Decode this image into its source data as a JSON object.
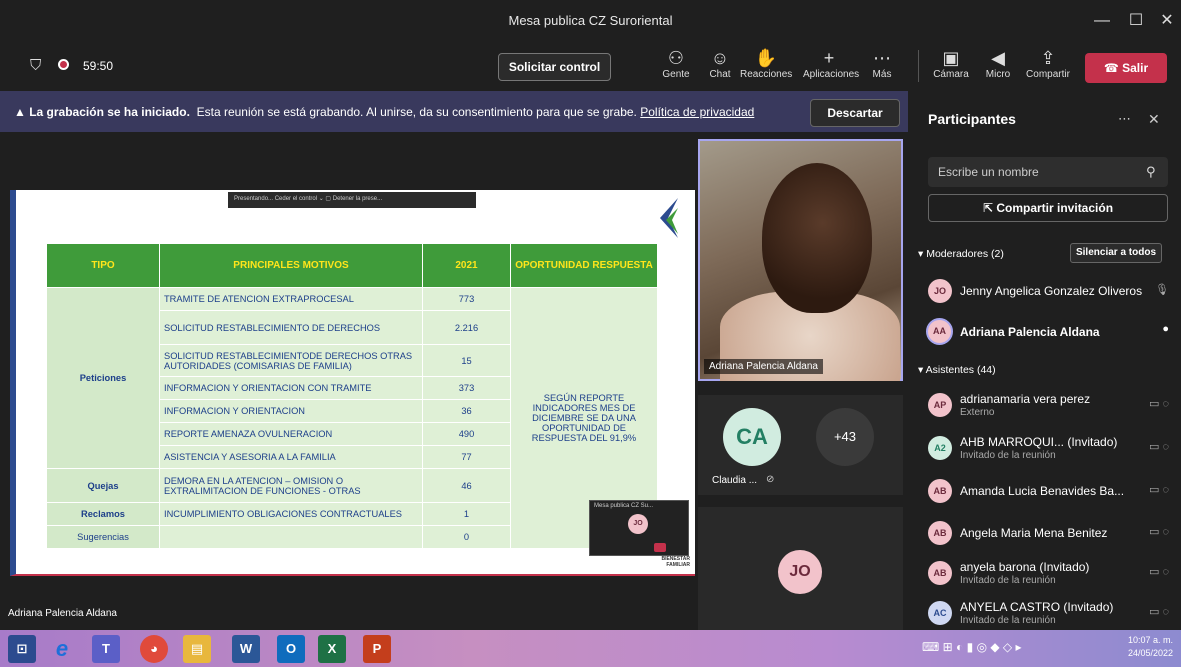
{
  "window": {
    "title": "Mesa publica CZ Suroriental",
    "controls": [
      "—",
      "☐",
      "✕"
    ]
  },
  "toolbar": {
    "timer": "59:50",
    "request_control": "Solicitar control",
    "buttons": [
      {
        "label": "Gente",
        "icon": "people-icon"
      },
      {
        "label": "Chat",
        "icon": "chat-icon"
      },
      {
        "label": "Reacciones",
        "icon": "reactions-icon"
      },
      {
        "label": "Aplicaciones",
        "icon": "apps-icon"
      },
      {
        "label": "Más",
        "icon": "more-icon"
      }
    ],
    "media": [
      {
        "label": "Cámara",
        "icon": "camera-off-icon"
      },
      {
        "label": "Micro",
        "icon": "mic-off-icon"
      },
      {
        "label": "Compartir",
        "icon": "share-icon"
      }
    ],
    "leave": "Salir"
  },
  "banner": {
    "bold": "La grabación se ha iniciado.",
    "text": "Esta reunión se está grabando. Al unirse, da su consentimiento para que se grabe.",
    "link": "Política de privacidad",
    "dismiss": "Descartar"
  },
  "slide": {
    "presenting_bar": "Presentando...     Ceder el control  ⌄    ▢   Detener la prese...",
    "headers": [
      "TIPO",
      "PRINCIPALES  MOTIVOS",
      "2021",
      "OPORTUNIDAD RESPUESTA"
    ],
    "rows": [
      {
        "motivo": "TRAMITE DE ATENCION EXTRAPROCESAL",
        "valor": "773"
      },
      {
        "motivo": "SOLICITUD RESTABLECIMIENTO DE DERECHOS",
        "valor": "2.216"
      },
      {
        "motivo": "SOLICITUD RESTABLECIMIENTODE DERECHOS  OTRAS AUTORIDADES (COMISARIAS DE FAMILIA)",
        "valor": "15"
      },
      {
        "motivo": "INFORMACION  Y ORIENTACION  CON TRAMITE",
        "valor": "373"
      },
      {
        "motivo": "INFORMACION Y ORIENTACION",
        "valor": "36"
      },
      {
        "motivo": "REPORTE AMENAZA OVULNERACION",
        "valor": "490"
      },
      {
        "motivo": "ASISTENCIA  Y ASESORIA  A LA FAMILIA",
        "valor": "77"
      },
      {
        "motivo": "DEMORA EN LA ATENCION – OMISION  O EXTRALIMITACION DE FUNCIONES  - OTRAS",
        "valor": "46"
      },
      {
        "motivo": "INCUMPLIMIENTO OBLIGACIONES CONTRACTUALES",
        "valor": "1"
      },
      {
        "motivo": "",
        "valor": "0"
      }
    ],
    "tipos": [
      "Peticiones",
      "Quejas",
      "Reclamos",
      "Sugerencias"
    ],
    "oportunidad": "SEGÚN  REPORTE INDICADORES  MES  DE DICIEMBRE  SE DA UNA OPORTUNIDAD DE RESPUESTA DEL 91,9%",
    "mini_window": {
      "title": "Mesa publica CZ Su...",
      "avatar": "JO"
    },
    "logo_text": "BIENESTAR FAMILIAR"
  },
  "video": {
    "main_name": "Adriana Palencia Aldana",
    "tile_ca": "CA",
    "tile_ca_name": "Claudia ...",
    "tile_more": "+43",
    "tile_jo": "JO",
    "presenter_label": "Adriana Palencia Aldana"
  },
  "panel": {
    "title": "Participantes",
    "search_placeholder": "Escribe un nombre",
    "invite": "Compartir invitación",
    "moderators_header": "Moderadores (2)",
    "mute_all": "Silenciar a todos",
    "moderators": [
      {
        "initials": "JO",
        "name": "Jenny Angelica Gonzalez Oliveros"
      },
      {
        "initials": "AA",
        "name": "Adriana Palencia Aldana"
      }
    ],
    "attendees_header": "Asistentes (44)",
    "attendees": [
      {
        "initials": "AP",
        "name": "adrianamaria vera perez",
        "sub": "Externo"
      },
      {
        "initials": "A2",
        "name": "AHB MARROQUI... (Invitado)",
        "sub": "Invitado de la reunión"
      },
      {
        "initials": "AB",
        "name": "Amanda Lucia Benavides Ba...",
        "sub": ""
      },
      {
        "initials": "AB",
        "name": "Angela Maria Mena Benitez",
        "sub": ""
      },
      {
        "initials": "AB",
        "name": "anyela barona (Invitado)",
        "sub": "Invitado de la reunión"
      },
      {
        "initials": "AC",
        "name": "ANYELA CASTRO (Invitado)",
        "sub": "Invitado de la reunión"
      }
    ]
  },
  "taskbar": {
    "apps": [
      "⊡",
      "e",
      "T",
      "◕",
      "▤",
      "W",
      "O",
      "X",
      "P"
    ],
    "time": "10:07 a. m.",
    "date": "24/05/2022"
  }
}
